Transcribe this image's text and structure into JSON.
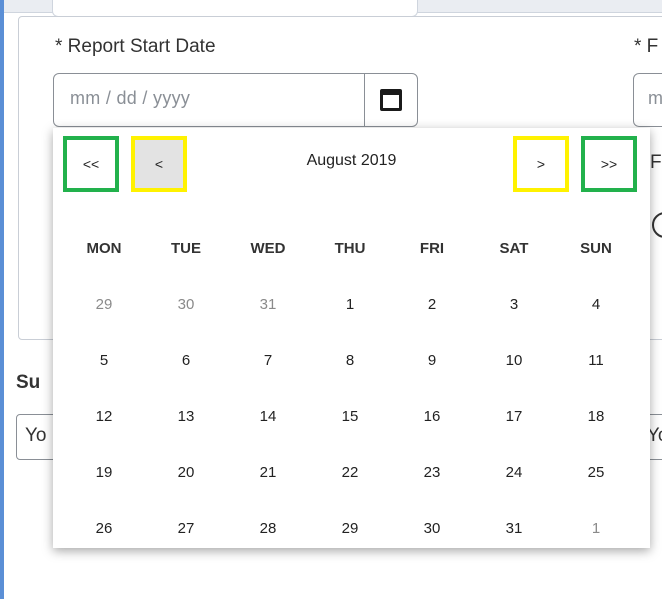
{
  "form": {
    "start_date_label": "* Report Start Date",
    "start_date_placeholder": "mm / dd / yyyy",
    "end_date_label": "* F",
    "end_date_placeholder": "m",
    "right_label_2": "F",
    "section_label": "Su",
    "left_field_value": "Yo",
    "right_field_value": "Yo"
  },
  "calendar": {
    "month_title": "August 2019",
    "nav": {
      "prev_year": "<<",
      "prev_month": "<",
      "next_month": ">",
      "next_year": ">>"
    },
    "weekdays": [
      "MON",
      "TUE",
      "WED",
      "THU",
      "FRI",
      "SAT",
      "SUN"
    ],
    "weeks": [
      [
        {
          "d": "29",
          "m": true
        },
        {
          "d": "30",
          "m": true
        },
        {
          "d": "31",
          "m": true
        },
        {
          "d": "1",
          "m": false
        },
        {
          "d": "2",
          "m": false
        },
        {
          "d": "3",
          "m": false
        },
        {
          "d": "4",
          "m": false
        }
      ],
      [
        {
          "d": "5",
          "m": false
        },
        {
          "d": "6",
          "m": false
        },
        {
          "d": "7",
          "m": false
        },
        {
          "d": "8",
          "m": false
        },
        {
          "d": "9",
          "m": false
        },
        {
          "d": "10",
          "m": false
        },
        {
          "d": "11",
          "m": false
        }
      ],
      [
        {
          "d": "12",
          "m": false
        },
        {
          "d": "13",
          "m": false
        },
        {
          "d": "14",
          "m": false
        },
        {
          "d": "15",
          "m": false
        },
        {
          "d": "16",
          "m": false
        },
        {
          "d": "17",
          "m": false
        },
        {
          "d": "18",
          "m": false
        }
      ],
      [
        {
          "d": "19",
          "m": false
        },
        {
          "d": "20",
          "m": false
        },
        {
          "d": "21",
          "m": false
        },
        {
          "d": "22",
          "m": false
        },
        {
          "d": "23",
          "m": false
        },
        {
          "d": "24",
          "m": false
        },
        {
          "d": "25",
          "m": false
        }
      ],
      [
        {
          "d": "26",
          "m": false
        },
        {
          "d": "27",
          "m": false
        },
        {
          "d": "28",
          "m": false
        },
        {
          "d": "29",
          "m": false
        },
        {
          "d": "30",
          "m": false
        },
        {
          "d": "31",
          "m": false
        },
        {
          "d": "1",
          "m": true
        }
      ]
    ]
  },
  "colors": {
    "highlight_green": "#22b14c",
    "highlight_yellow": "#fff200",
    "muted_day": "#8a8a8a"
  }
}
